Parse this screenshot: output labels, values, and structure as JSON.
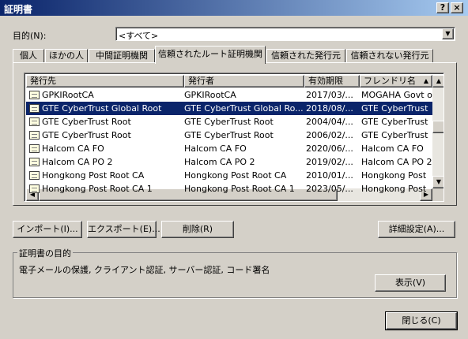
{
  "window": {
    "title": "証明書",
    "help_button": "?",
    "close_button": "×"
  },
  "purpose": {
    "label": "目的(N):",
    "value": "<すべて>"
  },
  "tabs": [
    {
      "label": "個人"
    },
    {
      "label": "ほかの人"
    },
    {
      "label": "中間証明機関"
    },
    {
      "label": "信頼されたルート証明機関"
    },
    {
      "label": "信頼された発行元"
    },
    {
      "label": "信頼されない発行元"
    }
  ],
  "list": {
    "columns": [
      "発行先",
      "発行者",
      "有効期限",
      "フレンドリ名"
    ],
    "rows": [
      {
        "issued_to": "GPKIRootCA",
        "issued_by": "GPKIRootCA",
        "expires": "2017/03/...",
        "friendly": "MOGAHA Govt o"
      },
      {
        "issued_to": "GTE CyberTrust Global Root",
        "issued_by": "GTE CyberTrust Global Ro...",
        "expires": "2018/08/...",
        "friendly": "GTE CyberTrust",
        "selected": true
      },
      {
        "issued_to": "GTE CyberTrust Root",
        "issued_by": "GTE CyberTrust Root",
        "expires": "2004/04/...",
        "friendly": "GTE CyberTrust"
      },
      {
        "issued_to": "GTE CyberTrust Root",
        "issued_by": "GTE CyberTrust Root",
        "expires": "2006/02/...",
        "friendly": "GTE CyberTrust"
      },
      {
        "issued_to": "Halcom CA FO",
        "issued_by": "Halcom CA FO",
        "expires": "2020/06/...",
        "friendly": "Halcom CA FO"
      },
      {
        "issued_to": "Halcom CA PO 2",
        "issued_by": "Halcom CA PO 2",
        "expires": "2019/02/...",
        "friendly": "Halcom CA PO 2"
      },
      {
        "issued_to": "Hongkong Post Root CA",
        "issued_by": "Hongkong Post Root CA",
        "expires": "2010/01/...",
        "friendly": "Hongkong Post"
      },
      {
        "issued_to": "Hongkong Post Root CA 1",
        "issued_by": "Hongkong Post Root CA 1",
        "expires": "2023/05/...",
        "friendly": "Hongkong Post"
      }
    ]
  },
  "buttons": {
    "import": "インポート(I)...",
    "export": "エクスポート(E)...",
    "remove": "削除(R)",
    "advanced": "詳細設定(A)...",
    "view": "表示(V)",
    "close": "閉じる(C)"
  },
  "purposes_group": {
    "title": "証明書の目的",
    "text": "電子メールの保護, クライアント認証, サーバー認証, コード署名"
  },
  "colors": {
    "titlebar": "#0a246a",
    "selection": "#0a246a",
    "face": "#d4d0c8"
  }
}
